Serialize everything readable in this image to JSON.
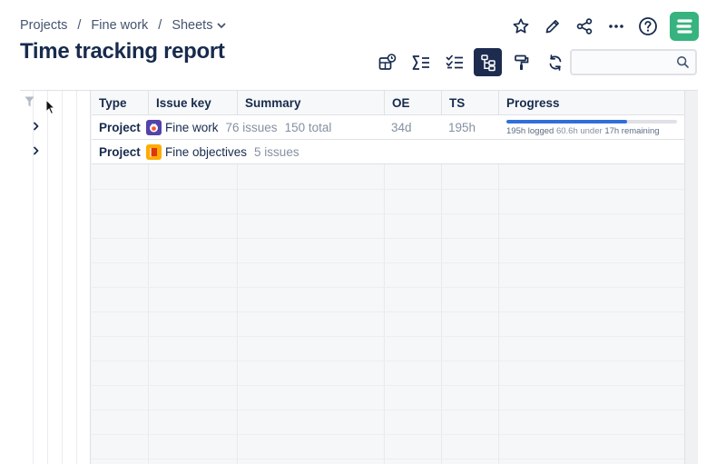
{
  "breadcrumb": {
    "items": [
      "Projects",
      "Fine work",
      "Sheets"
    ],
    "separator": "/"
  },
  "page": {
    "title": "Time tracking report"
  },
  "top_icons": [
    "star-icon",
    "pencil-icon",
    "share-icon",
    "more-icon",
    "help-icon",
    "app-logo"
  ],
  "toolbar": {
    "buttons": [
      "time-report-icon",
      "sum-icon",
      "checklist-icon",
      "hierarchy-icon",
      "paint-roller-icon",
      "refresh-icon"
    ],
    "active": "hierarchy-icon"
  },
  "search": {
    "placeholder": "",
    "value": ""
  },
  "table": {
    "columns": [
      "Type",
      "Issue key",
      "Summary",
      "OE",
      "TS",
      "Progress"
    ],
    "rows": [
      {
        "type": "Project",
        "key": "Fine work",
        "issues": "76 issues",
        "total": "150 total",
        "oe": "34d",
        "ts": "195h",
        "progress": {
          "fraction": 0.71,
          "logged": "195h logged",
          "under": "60.6h under",
          "remaining": "17h remaining"
        },
        "avatar_color": "#5243aa"
      },
      {
        "type": "Project",
        "key": "Fine objectives",
        "issues": "5 issues",
        "avatar_color": "#ffab00"
      }
    ]
  },
  "colors": {
    "accent": "#1d2b4f",
    "brand_green": "#36b37e",
    "progress": "#2f6fdc"
  }
}
